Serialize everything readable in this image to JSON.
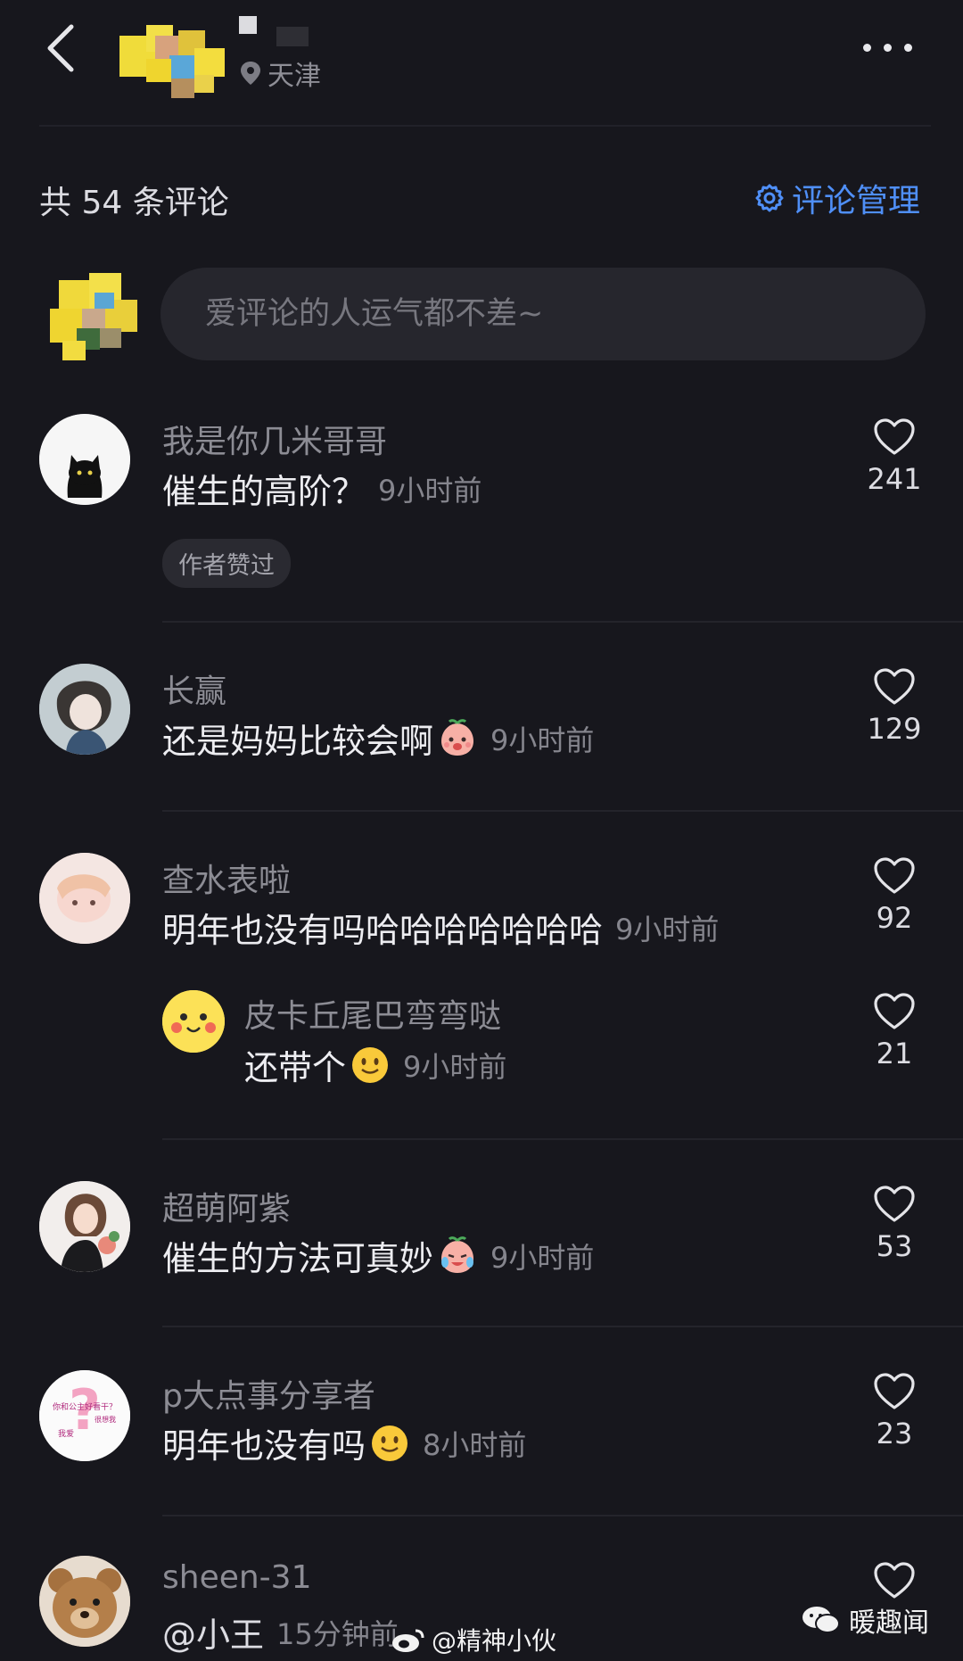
{
  "header": {
    "location": "天津",
    "icons": {
      "back": "chevron-left-icon",
      "more": "more-dots-icon",
      "location": "location-pin-icon"
    }
  },
  "comments_header": {
    "count_label": "共 54 条评论",
    "manage_label": "评论管理"
  },
  "input": {
    "placeholder": "爱评论的人运气都不差~"
  },
  "comments": [
    {
      "name": "我是你几米哥哥",
      "text": "催生的高阶？",
      "time": "9小时前",
      "likes": "241",
      "tag": "作者赞过"
    },
    {
      "name": "长赢",
      "text": "还是妈妈比较会啊",
      "emoji": "peach-shy-emoji",
      "time": "9小时前",
      "likes": "129"
    },
    {
      "name": "查水表啦",
      "text": "明年也没有吗哈哈哈哈哈哈哈",
      "time": "9小时前",
      "likes": "92"
    },
    {
      "name": "皮卡丘尾巴弯弯哒",
      "text": "还带个",
      "emoji": "smile-emoji",
      "time": "9小时前",
      "likes": "21"
    },
    {
      "name": "超萌阿紫",
      "text": "催生的方法可真妙",
      "emoji": "peach-crying-laugh-emoji",
      "time": "9小时前",
      "likes": "53"
    },
    {
      "name": "p大点事分享者",
      "text": "明年也没有吗",
      "emoji": "smile-emoji",
      "time": "8小时前",
      "likes": "23"
    },
    {
      "name": "sheen-31",
      "text": "@小王",
      "time": "15分钟前",
      "likes": ""
    }
  ],
  "avatar_text": {
    "lines": [
      "你和公主好看干？",
      "我爱",
      "很想我"
    ]
  },
  "watermarks": {
    "weibo": "@精神小伙",
    "wechat": "暖趣闻"
  },
  "colors": {
    "background": "#17171d",
    "accent": "#4f8ff7"
  }
}
